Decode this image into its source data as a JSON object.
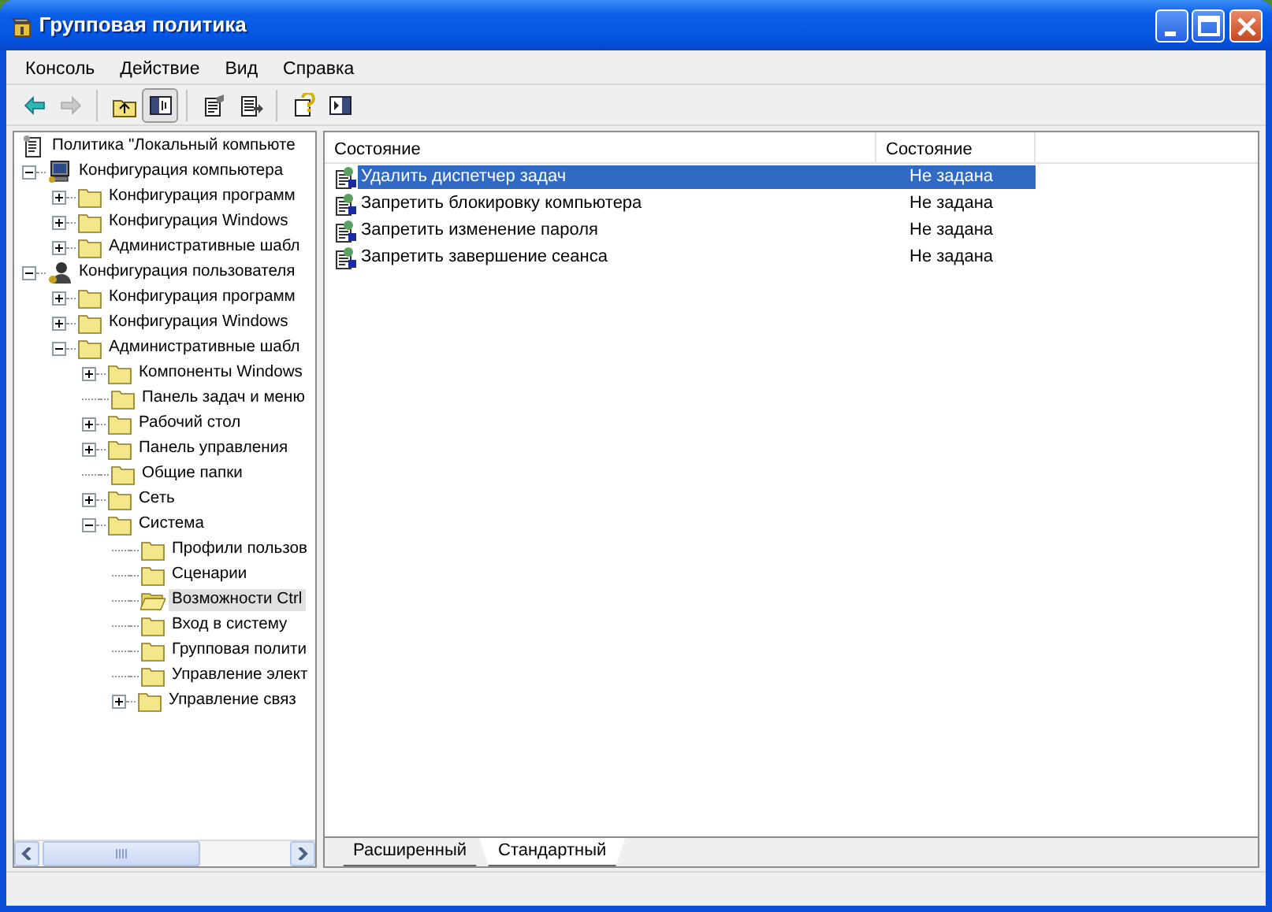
{
  "window": {
    "title": "Групповая политика"
  },
  "menu": [
    "Консоль",
    "Действие",
    "Вид",
    "Справка"
  ],
  "toolbar": [
    [
      {
        "kind": "back",
        "disabled": false,
        "pressed": false
      },
      {
        "kind": "forward",
        "disabled": true,
        "pressed": false
      }
    ],
    [
      {
        "kind": "up-folder",
        "disabled": false,
        "pressed": false
      },
      {
        "kind": "tree-toggle",
        "disabled": false,
        "pressed": true
      }
    ],
    [
      {
        "kind": "properties",
        "disabled": false,
        "pressed": false
      },
      {
        "kind": "export",
        "disabled": false,
        "pressed": false
      }
    ],
    [
      {
        "kind": "help",
        "disabled": false,
        "pressed": false
      },
      {
        "kind": "panel",
        "disabled": false,
        "pressed": false
      }
    ]
  ],
  "tree": [
    {
      "label": "Политика \"Локальный компьюте",
      "kind": "policy",
      "selected": false,
      "children": [
        {
          "label": "Конфигурация компьютера",
          "kind": "computer",
          "expanded": true,
          "selected": false,
          "children": [
            {
              "label": "Конфигурация программ",
              "kind": "folder",
              "expanded": false,
              "selected": false
            },
            {
              "label": "Конфигурация Windows",
              "kind": "folder",
              "expanded": false,
              "selected": false
            },
            {
              "label": "Административные шабл",
              "kind": "folder",
              "expanded": false,
              "selected": false
            }
          ]
        },
        {
          "label": "Конфигурация пользователя",
          "kind": "user",
          "expanded": true,
          "selected": false,
          "children": [
            {
              "label": "Конфигурация программ",
              "kind": "folder",
              "expanded": false,
              "selected": false
            },
            {
              "label": "Конфигурация Windows",
              "kind": "folder",
              "expanded": false,
              "selected": false
            },
            {
              "label": "Административные шабл",
              "kind": "folder",
              "expanded": true,
              "selected": false,
              "children": [
                {
                  "label": "Компоненты Windows",
                  "kind": "folder",
                  "expanded": false,
                  "selected": false
                },
                {
                  "label": "Панель задач и меню",
                  "kind": "folder",
                  "selected": false
                },
                {
                  "label": "Рабочий стол",
                  "kind": "folder",
                  "expanded": false,
                  "selected": false
                },
                {
                  "label": "Панель управления",
                  "kind": "folder",
                  "expanded": false,
                  "selected": false
                },
                {
                  "label": "Общие папки",
                  "kind": "folder",
                  "selected": false
                },
                {
                  "label": "Сеть",
                  "kind": "folder",
                  "expanded": false,
                  "selected": false
                },
                {
                  "label": "Система",
                  "kind": "folder",
                  "expanded": true,
                  "selected": false,
                  "children": [
                    {
                      "label": "Профили пользов",
                      "kind": "folder",
                      "selected": false
                    },
                    {
                      "label": "Сценарии",
                      "kind": "folder",
                      "selected": false
                    },
                    {
                      "label": "Возможности Ctrl",
                      "kind": "folder",
                      "selected": true
                    },
                    {
                      "label": "Вход в систему",
                      "kind": "folder",
                      "selected": false
                    },
                    {
                      "label": "Групповая полити",
                      "kind": "folder",
                      "selected": false
                    },
                    {
                      "label": "Управление элект",
                      "kind": "folder",
                      "selected": false
                    },
                    {
                      "label": "Управление связ",
                      "kind": "folder",
                      "expanded": false,
                      "selected": false
                    }
                  ]
                }
              ]
            }
          ]
        }
      ]
    }
  ],
  "list": {
    "columns": [
      "Состояние",
      "Состояние"
    ],
    "rows": [
      {
        "name": "Удалить диспетчер задач",
        "state": "Не задана",
        "selected": true
      },
      {
        "name": "Запретить блокировку компьютера",
        "state": "Не задана",
        "selected": false
      },
      {
        "name": "Запретить изменение пароля",
        "state": "Не задана",
        "selected": false
      },
      {
        "name": "Запретить завершение сеанса",
        "state": "Не задана",
        "selected": false
      }
    ]
  },
  "tabs": [
    {
      "label": "Расширенный",
      "selected": false
    },
    {
      "label": "Стандартный",
      "selected": true
    }
  ]
}
